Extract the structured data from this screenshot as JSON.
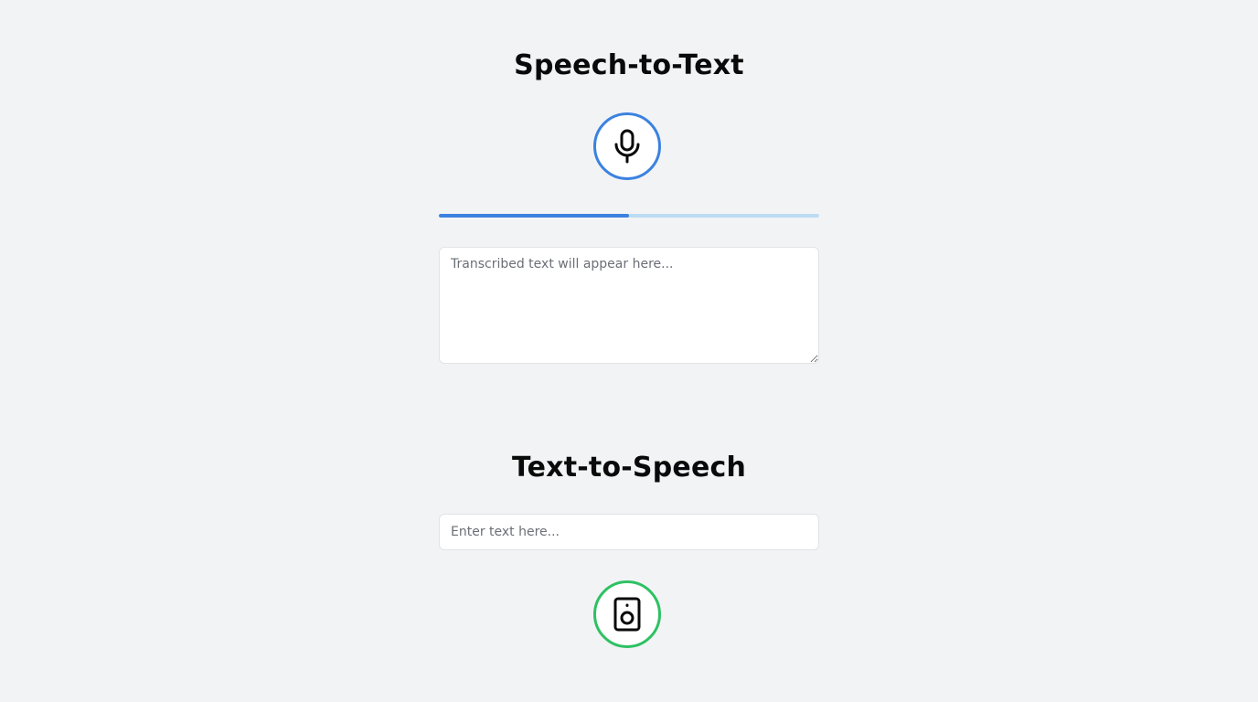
{
  "speech_to_text": {
    "title": "Speech-to-Text",
    "mic_icon": "microphone-icon",
    "accent_color": "#3b82e0",
    "progress_fraction": 0.5,
    "transcript_placeholder": "Transcribed text will appear here..."
  },
  "text_to_speech": {
    "title": "Text-to-Speech",
    "input_placeholder": "Enter text here...",
    "speaker_icon": "speaker-icon",
    "accent_color": "#2ec163"
  }
}
